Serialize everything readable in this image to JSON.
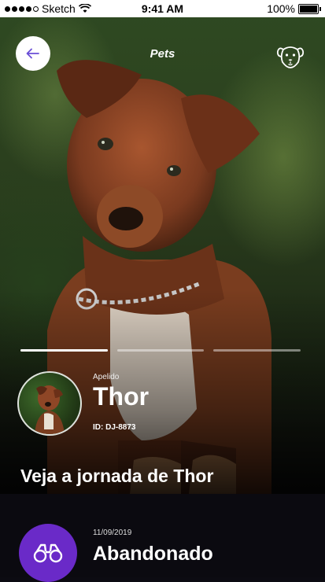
{
  "status_bar": {
    "carrier": "Sketch",
    "time": "9:41 AM",
    "battery": "100%",
    "icons": [
      "signal-dots-icon",
      "wifi-icon",
      "battery-icon"
    ]
  },
  "header": {
    "title": "Pets",
    "back_icon": "arrow-left-icon",
    "action_icon": "dog-face-icon"
  },
  "story": {
    "segments": 3,
    "active_segment": 1,
    "progress": [
      1.0,
      0.0,
      0.0
    ]
  },
  "pet": {
    "nickname_label": "Apelido",
    "name": "Thor",
    "id": "ID: DJ-8873"
  },
  "journey": {
    "heading": "Veja a jornada de Thor"
  },
  "event": {
    "date": "11/09/2019",
    "title": "Abandonado",
    "icon": "binoculars-icon"
  },
  "colors": {
    "accent": "#6a2ac8",
    "back_arrow": "#6a4fd6",
    "background": "#0b0a10"
  }
}
